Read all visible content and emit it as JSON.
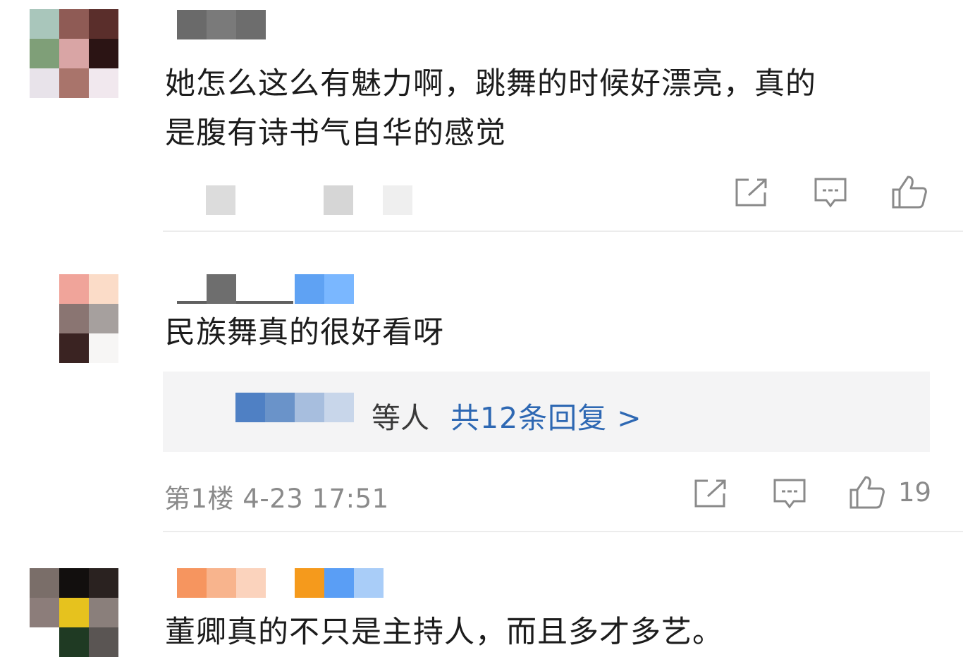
{
  "comments": [
    {
      "text_line1": "她怎么这么有魅力啊，跳舞的时候好漂亮，真的",
      "text_line2": "是腹有诗书气自华的感觉",
      "avatar_colors": [
        "#a9c6bb",
        "#8f5b55",
        "#5a2e2b",
        "#7f9f78",
        "#d9a5a5",
        "#2b1414",
        "#e8e3ea",
        "#a9746b",
        "#f1e8ee"
      ],
      "name_colors": [
        "#6a6a6a",
        "#7a7a7a",
        "#6d6d6d"
      ]
    },
    {
      "text": "民族舞真的很好看呀",
      "avatar_colors": [
        "#f0a49a",
        "#fbdcc8",
        "#ffffff",
        "#8a7572",
        "#a6a09e",
        "#ffffff",
        "#3a2322",
        "#f7f6f5",
        "#ffffff"
      ],
      "name_colors": [
        "#6e6e6e",
        "#5fa2f3",
        "#7ab7ff"
      ],
      "reply": {
        "names_label": "等人",
        "link_label": "共12条回复 >",
        "mask_colors": [
          "#4f80c4",
          "#6a93c9",
          "#a7bede",
          "#c8d6ea"
        ]
      },
      "meta": "第1楼 4-23 17:51",
      "likes": "19"
    },
    {
      "text": "董卿真的不只是主持人，而且多才多艺。",
      "avatar_colors": [
        "#7a6e69",
        "#120f0e",
        "#2a2220",
        "#8c7d7a",
        "#e6c21e",
        "#8a7f7b",
        "#ffffff",
        "#1f3a23",
        "#5a5553"
      ],
      "name_colors": [
        "#f6955f",
        "#f8b48d",
        "#fbd3bd",
        "#f59a1c",
        "#5a9ef5",
        "#a9cdf8"
      ]
    }
  ],
  "icons": {
    "share": "share-icon",
    "comment": "comment-icon",
    "like": "thumbs-up-icon"
  }
}
